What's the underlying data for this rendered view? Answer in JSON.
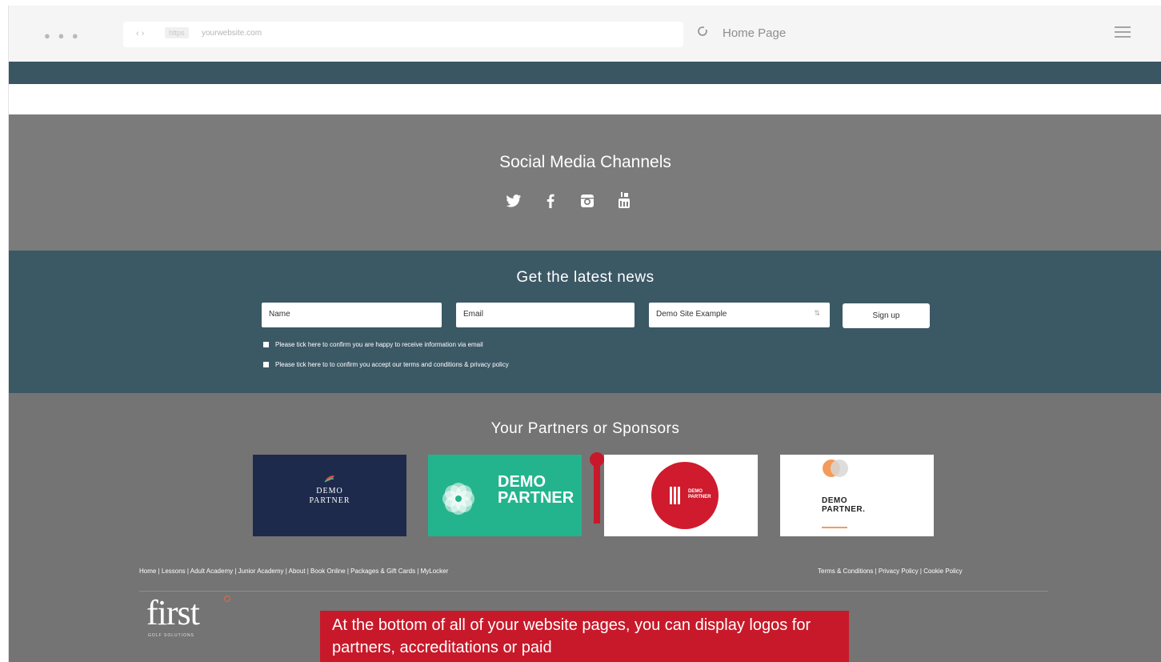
{
  "browser": {
    "nav_arrows": "‹ ›",
    "https_label": "https",
    "url": "yourwebsite.com",
    "reload_icon": "reload-icon",
    "page_title": "Home Page",
    "menu_icon": "hamburger-menu-icon"
  },
  "social": {
    "title": "Social Media Channels",
    "icons": [
      "twitter-icon",
      "facebook-icon",
      "instagram-icon",
      "youtube-icon"
    ]
  },
  "newsletter": {
    "title": "Get the latest news",
    "name_placeholder": "Name",
    "email_placeholder": "Email",
    "site_select": "Demo Site Example",
    "signup_label": "Sign up",
    "consent_email": "Please tick here to confirm you are happy to receive information via email",
    "consent_terms": "Please tick here to to confirm you accept our terms and conditions & privacy policy"
  },
  "partners": {
    "title": "Your Partners or Sponsors",
    "logos": [
      {
        "line1": "DEMO",
        "line2": "PARTNER"
      },
      {
        "line1": "DEMO",
        "line2": "PARTNER"
      },
      {
        "line1": "DEMO",
        "line2": "PARTNER"
      },
      {
        "line1": "DEMO",
        "line2": "PARTNER."
      }
    ]
  },
  "footer": {
    "nav_left": "Home  |  Lessons  |  Adult Academy  |  Junior Academy  |  About  |  Book Online  |  Packages & Gift Cards  |  MyLocker",
    "nav_right": "Terms & Conditions  |  Privacy Policy  |  Cookie Policy",
    "brand": "first",
    "brand_sub": "GOLF SOLUTIONS"
  },
  "annotation": {
    "text": "At the bottom of all of your website pages, you can display logos for partners, accreditations or paid"
  },
  "colors": {
    "accent_red": "#c8192a",
    "dark_teal": "#3b5865",
    "grey": "#7b7b7b",
    "partner_green": "#23b48d",
    "partner_navy": "#1e2a4c"
  }
}
